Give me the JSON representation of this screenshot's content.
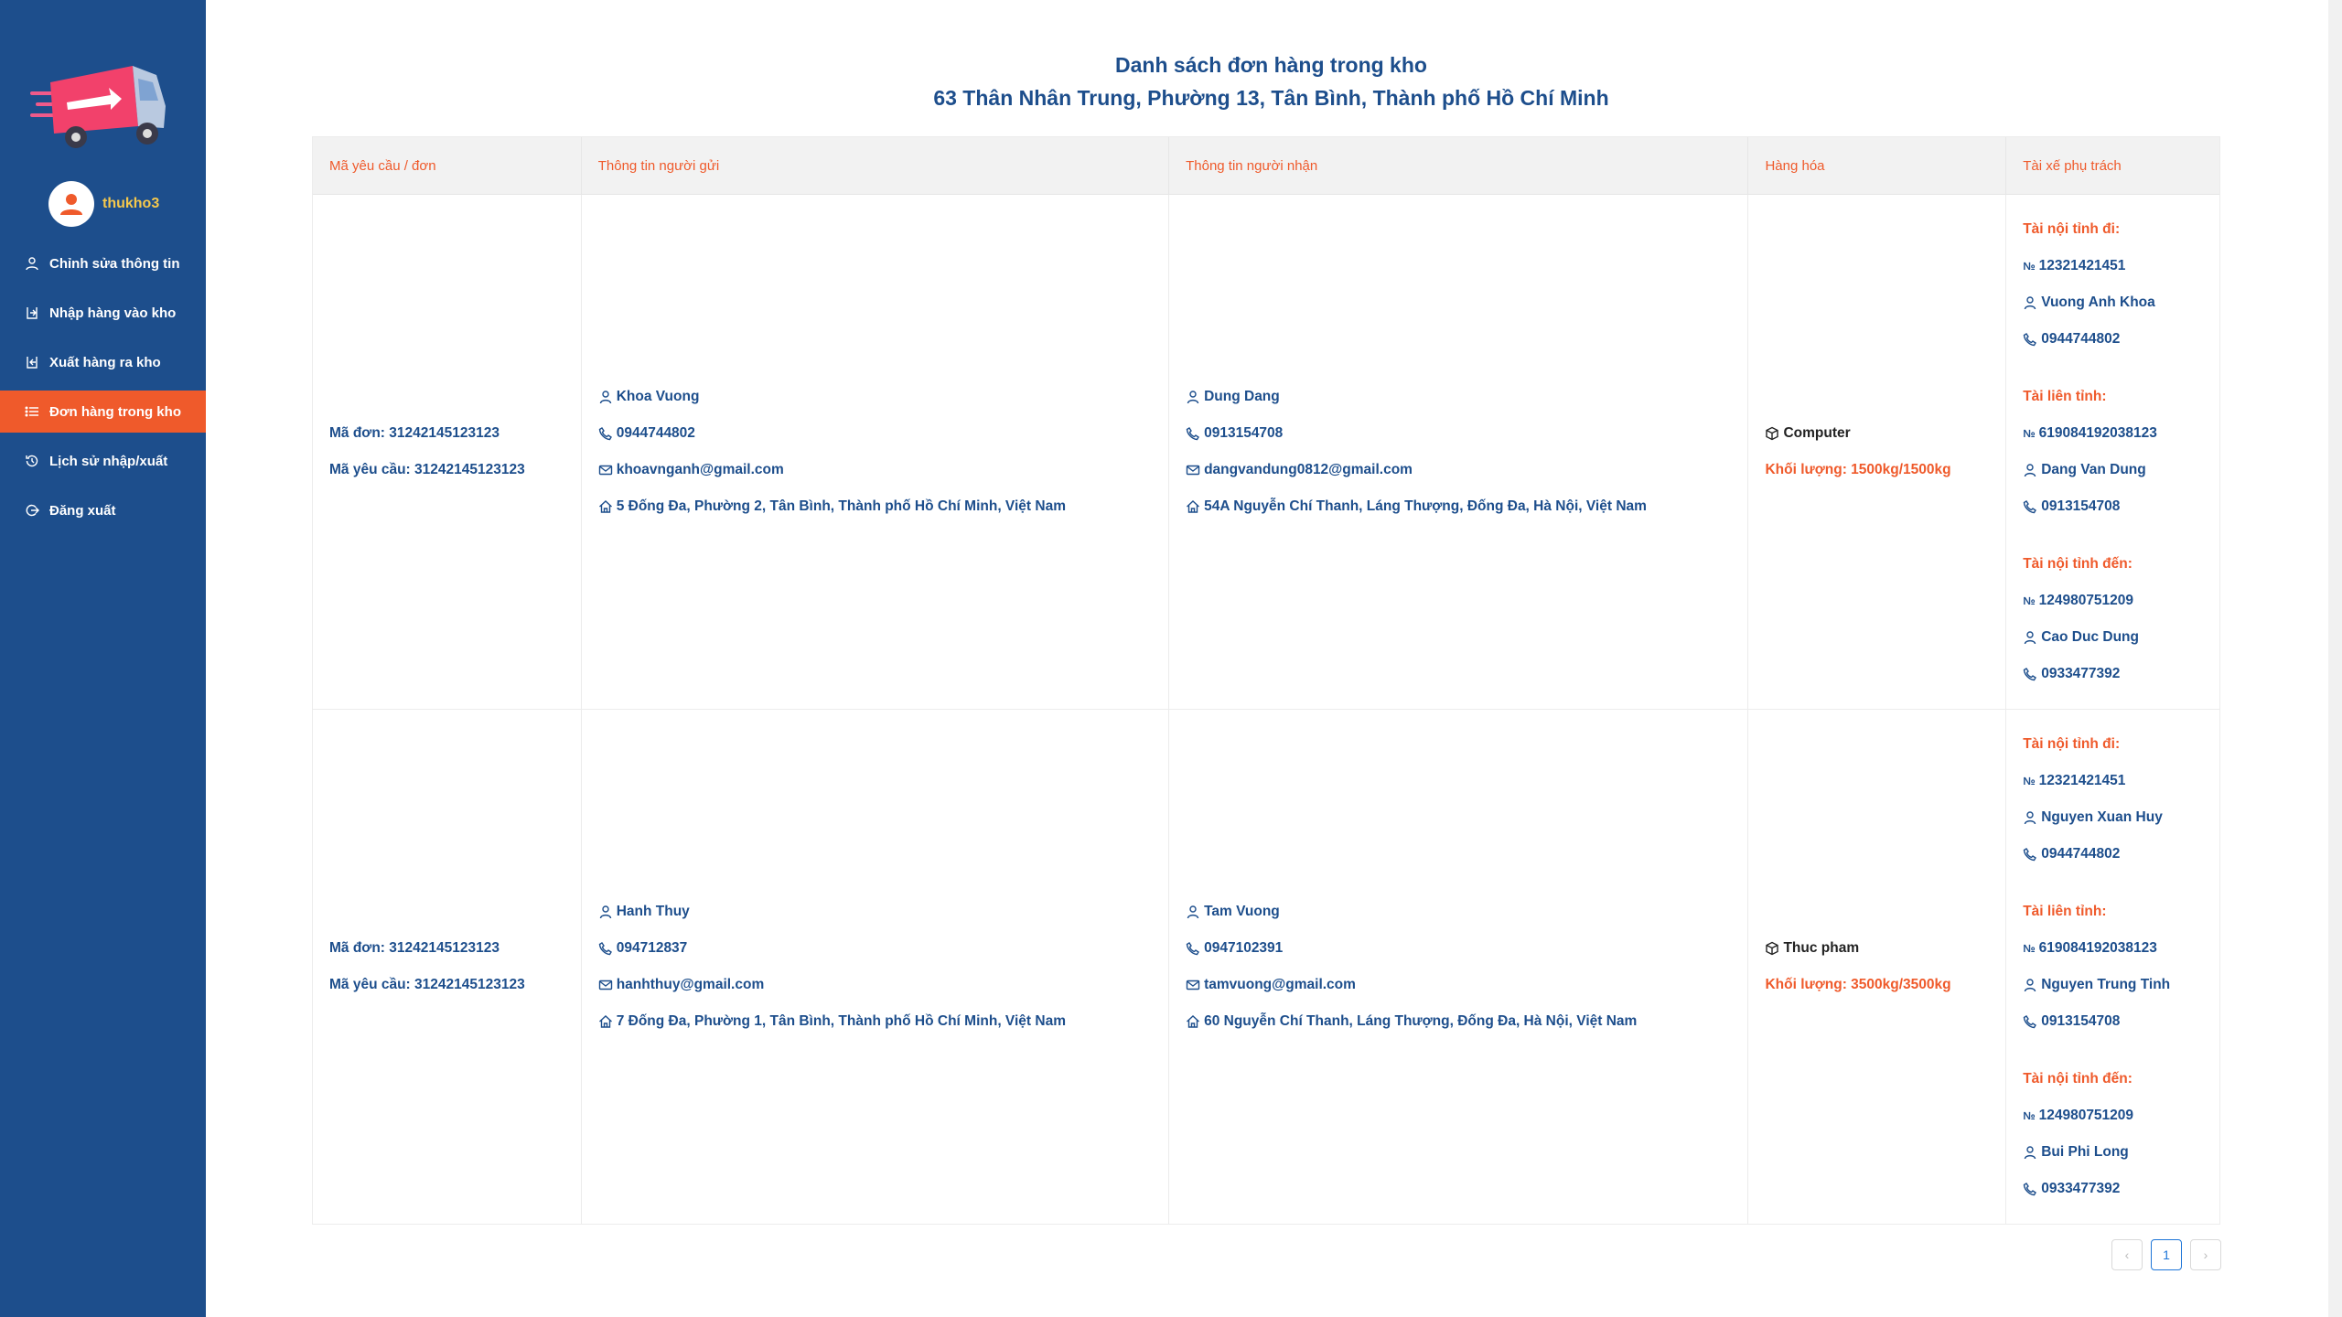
{
  "sidebar": {
    "username": "thukho3",
    "items": [
      {
        "label": "Chỉnh sửa thông tin",
        "icon": "user-icon"
      },
      {
        "label": "Nhập hàng vào kho",
        "icon": "import-icon"
      },
      {
        "label": "Xuất hàng ra kho",
        "icon": "export-icon"
      },
      {
        "label": "Đơn hàng trong kho",
        "icon": "list-icon",
        "active": true
      },
      {
        "label": "Lịch sử nhập/xuất",
        "icon": "history-icon"
      },
      {
        "label": "Đăng xuất",
        "icon": "logout-icon"
      }
    ]
  },
  "header": {
    "title": "Danh sách đơn hàng trong kho",
    "address": "63 Thân Nhân Trung, Phường 13, Tân Bình, Thành phố Hồ Chí Minh"
  },
  "table": {
    "columns": [
      "Mã yêu cầu / đơn",
      "Thông tin người gửi",
      "Thông tin người nhận",
      "Hàng hóa",
      "Tài xế phụ trách"
    ],
    "rows": [
      {
        "order_code": "Mã đơn: 31242145123123",
        "request_code": "Mã yêu cầu: 31242145123123",
        "sender": {
          "name": "Khoa Vuong",
          "phone": "0944744802",
          "email": "khoavnganh@gmail.com",
          "address": "5 Đống Đa, Phường 2, Tân Bình, Thành phố Hồ Chí Minh, Việt Nam"
        },
        "receiver": {
          "name": "Dung Dang",
          "phone": "0913154708",
          "email": "dangvandung0812@gmail.com",
          "address": "54A Nguyễn Chí Thanh, Láng Thượng, Đống Đa, Hà Nội, Việt Nam"
        },
        "goods": {
          "name": "Computer",
          "weight": "Khối lượng: 1500kg/1500kg"
        },
        "drivers": [
          {
            "title": "Tài nội tỉnh đi:",
            "id": "12321421451",
            "name": "Vuong Anh Khoa",
            "phone": "0944744802"
          },
          {
            "title": "Tài liên tỉnh:",
            "id": "619084192038123",
            "name": "Dang Van Dung",
            "phone": "0913154708"
          },
          {
            "title": "Tài nội tỉnh đến:",
            "id": "124980751209",
            "name": "Cao Duc Dung",
            "phone": "0933477392"
          }
        ]
      },
      {
        "order_code": "Mã đơn: 31242145123123",
        "request_code": "Mã yêu cầu: 31242145123123",
        "sender": {
          "name": "Hanh Thuy",
          "phone": "094712837",
          "email": "hanhthuy@gmail.com",
          "address": "7 Đống Đa, Phường 1, Tân Bình, Thành phố Hồ Chí Minh, Việt Nam"
        },
        "receiver": {
          "name": "Tam Vuong",
          "phone": "0947102391",
          "email": "tamvuong@gmail.com",
          "address": "60 Nguyễn Chí Thanh, Láng Thượng, Đống Đa, Hà Nội, Việt Nam"
        },
        "goods": {
          "name": "Thuc pham",
          "weight": "Khối lượng: 3500kg/3500kg"
        },
        "drivers": [
          {
            "title": "Tài nội tỉnh đi:",
            "id": "12321421451",
            "name": "Nguyen Xuan Huy",
            "phone": "0944744802"
          },
          {
            "title": "Tài liên tỉnh:",
            "id": "619084192038123",
            "name": "Nguyen Trung Tinh",
            "phone": "0913154708"
          },
          {
            "title": "Tài nội tỉnh đến:",
            "id": "124980751209",
            "name": "Bui Phi Long",
            "phone": "0933477392"
          }
        ]
      }
    ]
  },
  "pagination": {
    "prev": "‹",
    "current": "1",
    "next": "›"
  },
  "colors": {
    "sidebar": "#1d4e8c",
    "accent": "#ef5a2b",
    "text": "#1d4e8c"
  }
}
